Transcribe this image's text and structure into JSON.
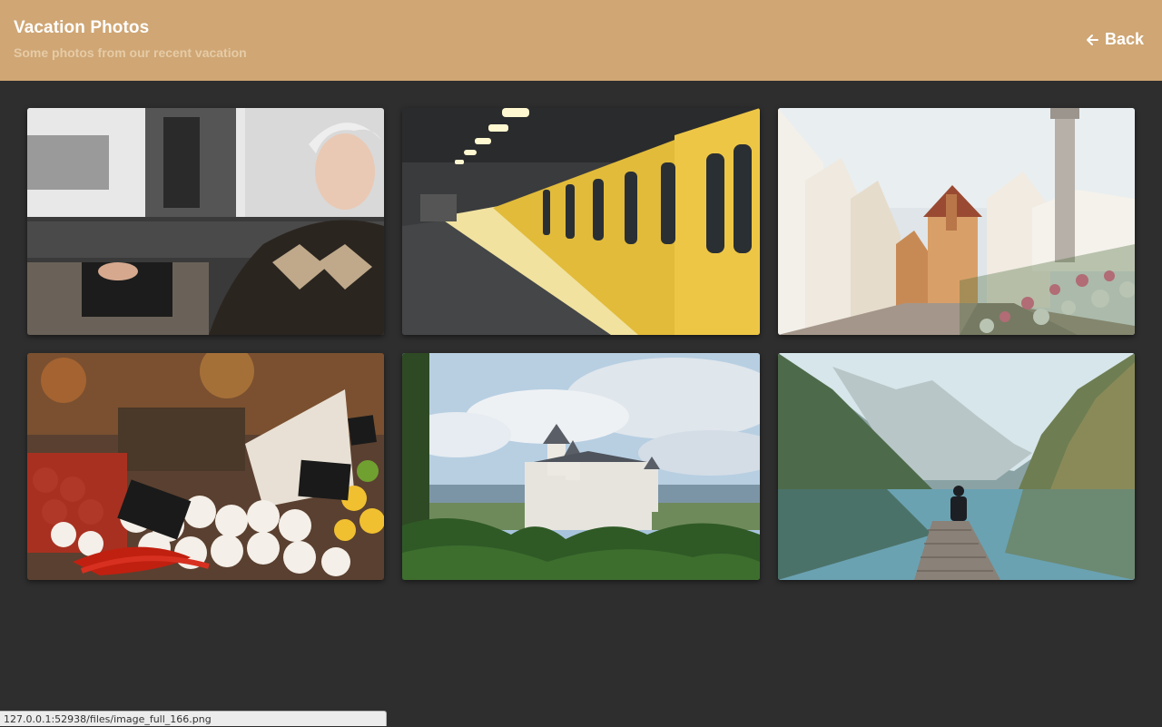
{
  "header": {
    "title": "Vacation Photos",
    "subtitle": "Some photos from our recent vacation",
    "back_label": "Back",
    "back_icon": "arrow-left-icon",
    "background_color": "#cfa674"
  },
  "gallery": {
    "photos": [
      {
        "name": "portrait-woman"
      },
      {
        "name": "yellow-subway-train"
      },
      {
        "name": "medieval-town-street"
      },
      {
        "name": "market-stall-garlic"
      },
      {
        "name": "castle-on-hill"
      },
      {
        "name": "lake-dock-mountains"
      }
    ]
  },
  "statusbar": {
    "url": "127.0.0.1:52938/files/image_full_166.png"
  }
}
